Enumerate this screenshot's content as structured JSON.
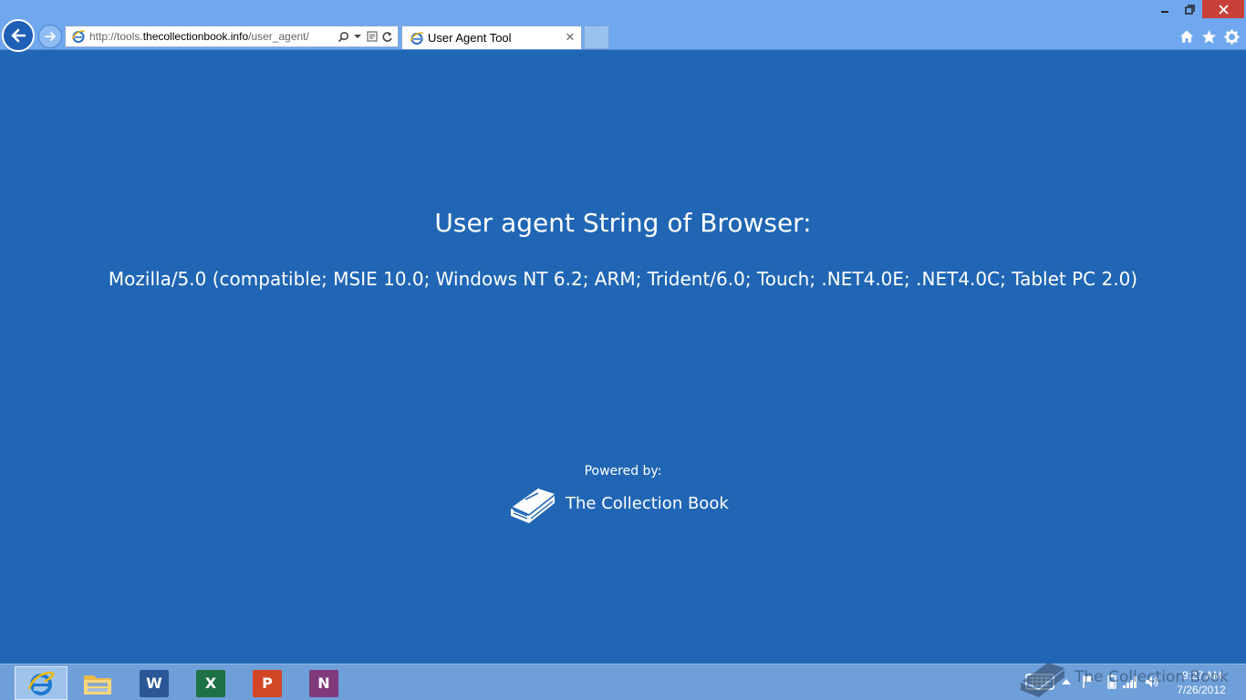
{
  "browser": {
    "url_prefix": "http://tools.",
    "url_domain": "thecollectionbook.info",
    "url_path": "/user_agent/",
    "tab_title": "User Agent Tool",
    "icons": {
      "back": "back-arrow-icon",
      "forward": "forward-arrow-icon",
      "search": "search-icon",
      "compat": "compatibility-view-icon",
      "refresh": "refresh-icon",
      "home": "home-icon",
      "favorites": "star-icon",
      "tools": "gear-icon"
    }
  },
  "page": {
    "heading": "User agent String of Browser:",
    "user_agent": "Mozilla/5.0 (compatible; MSIE 10.0; Windows NT 6.2; ARM; Trident/6.0; Touch; .NET4.0E; .NET4.0C; Tablet PC 2.0)",
    "powered_by": "Powered by:",
    "brand": "The Collection Book",
    "background_color": "#2066b4"
  },
  "taskbar": {
    "apps": [
      {
        "name": "Internet Explorer",
        "letter": "e",
        "active": true
      },
      {
        "name": "File Explorer",
        "letter": ""
      },
      {
        "name": "Word",
        "letter": "W",
        "color": "#2b5797"
      },
      {
        "name": "Excel",
        "letter": "X",
        "color": "#1e7145"
      },
      {
        "name": "PowerPoint",
        "letter": "P",
        "color": "#d24726"
      },
      {
        "name": "OneNote",
        "letter": "N",
        "color": "#80397b"
      }
    ],
    "clock_time": "9:27 AM",
    "clock_date": "7/26/2012"
  },
  "watermark": {
    "text": "The Collection Book"
  }
}
